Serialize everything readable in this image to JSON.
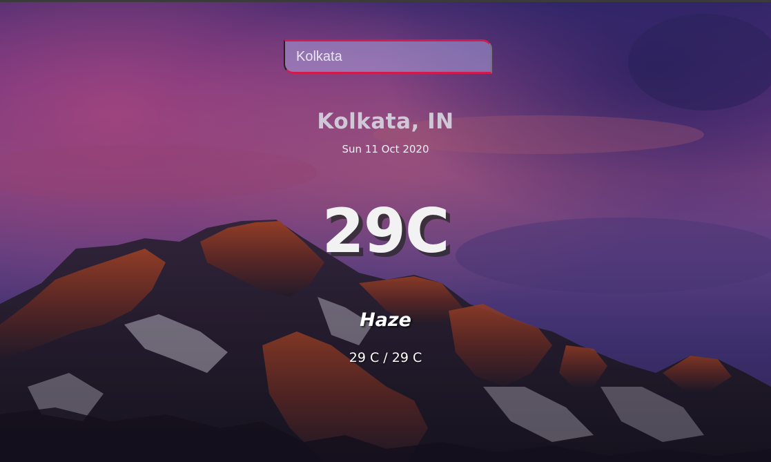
{
  "search": {
    "value": "Kolkata",
    "placeholder": ""
  },
  "weather": {
    "location": "Kolkata, IN",
    "date": "Sun 11 Oct 2020",
    "temperature": "29C",
    "condition": "Haze",
    "hi_low": "29 C / 29 C"
  },
  "background": {
    "image": "mountain-sunset-landscape",
    "sky_colors": [
      "#3b2a7a",
      "#7a3a8e",
      "#c0507a"
    ],
    "mountain_colors": [
      "#a8472a",
      "#2c2233",
      "#d8d2e2"
    ]
  }
}
